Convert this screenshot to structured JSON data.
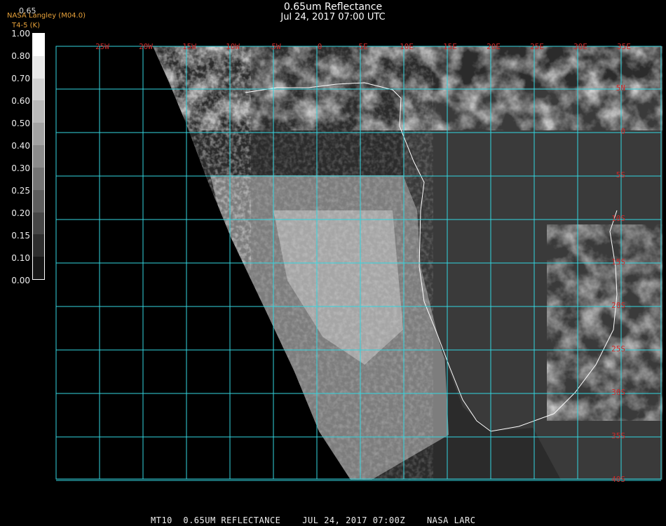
{
  "title": "0.65um Reflectance",
  "subtitle": "Jul 24, 2017 07:00 UTC",
  "org_label": "NASA Langley (M04.0)",
  "org_sub": "T4-5 (K)",
  "ghost_label": "0.65",
  "colorbar": {
    "ticks": [
      "1.00",
      "0.80",
      "0.70",
      "0.60",
      "0.50",
      "0.40",
      "0.30",
      "0.25",
      "0.20",
      "0.15",
      "0.10",
      "0.00"
    ]
  },
  "map": {
    "lon_labels": [
      "25W",
      "20W",
      "15W",
      "10W",
      "5W",
      "0",
      "5E",
      "10E",
      "15E",
      "20E",
      "25E",
      "30E",
      "35E"
    ],
    "lat_labels": [
      "5N",
      "0",
      "5S",
      "10S",
      "15S",
      "20S",
      "25S",
      "30S",
      "35S",
      "40S"
    ],
    "grid_color": "#33d6e0",
    "label_color": "#cc2a2a"
  },
  "footer": "MT10  0.65UM REFLECTANCE    JUL 24, 2017 07:00Z    NASA LARC"
}
